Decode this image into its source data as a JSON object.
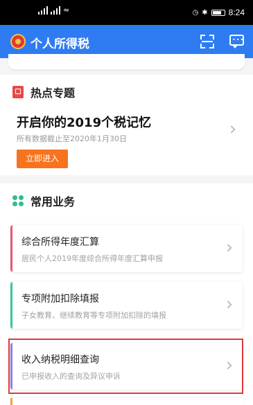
{
  "status_bar": {
    "time": "8:24",
    "wifi": "≈",
    "bluetooth": "✱",
    "alarm": "◷"
  },
  "header": {
    "title": "个人所得税"
  },
  "hot": {
    "section_title": "热点专题",
    "card_title": "开启你的2019个税记忆",
    "card_subtitle": "所有数据截止至2020年1月30日",
    "button_label": "立即进入"
  },
  "common": {
    "section_title": "常用业务",
    "items": [
      {
        "title": "综合所得年度汇算",
        "desc": "居民个人2019年度综合所得年度汇算申报",
        "accent": "#e9576f"
      },
      {
        "title": "专项附加扣除填报",
        "desc": "子女教育、继续教育等专项附加扣除的填报",
        "accent": "#37c88e"
      },
      {
        "title": "收入纳税明细查询",
        "desc": "已申报收入的查询及异议申诉",
        "accent": "#8f7be8"
      }
    ]
  },
  "colors": {
    "primary": "#2f7cf2",
    "orange": "#f7731d",
    "highlight": "#e13838"
  }
}
